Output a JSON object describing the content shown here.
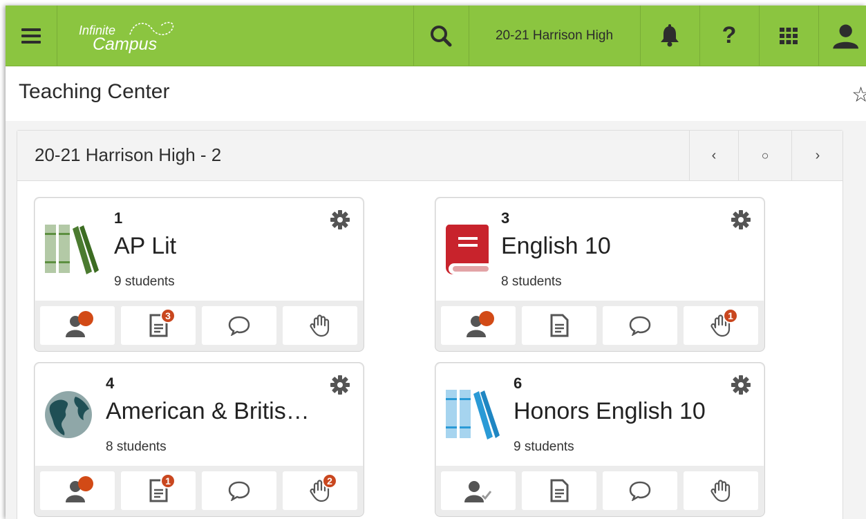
{
  "app": {
    "logo_line1": "Infinite",
    "logo_line2": "Campus"
  },
  "topbar": {
    "school": "20-21 Harrison High"
  },
  "page": {
    "title": "Teaching Center"
  },
  "schedule": {
    "title": "20-21 Harrison High - 2"
  },
  "colors": {
    "brand_green": "#8bc540",
    "badge_red": "#c9471f",
    "text_dark": "#222222"
  },
  "cards": [
    {
      "period": "1",
      "name": "AP Lit",
      "students": "9 students",
      "icon": "books-green-icon",
      "roster_alert": true,
      "grade_badge": "3",
      "hand_badge": ""
    },
    {
      "period": "3",
      "name": "English 10",
      "students": "8 students",
      "icon": "red-book-icon",
      "roster_alert": true,
      "grade_badge": "",
      "hand_badge": "1"
    },
    {
      "period": "4",
      "name": "American & Britis…",
      "students": "8 students",
      "icon": "globe-icon",
      "roster_alert": true,
      "grade_badge": "1",
      "hand_badge": "2"
    },
    {
      "period": "6",
      "name": "Honors English 10",
      "students": "9 students",
      "icon": "books-blue-icon",
      "roster_alert": false,
      "grade_badge": "",
      "hand_badge": ""
    }
  ]
}
